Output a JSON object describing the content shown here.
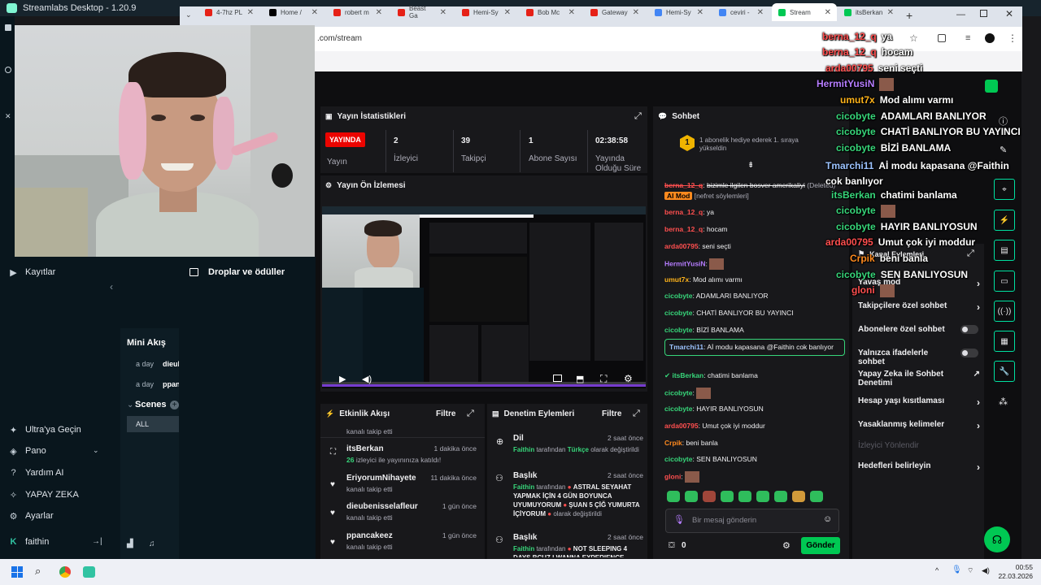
{
  "app": {
    "title": "Streamlabs Desktop - 1.20.9",
    "drops_title": "Droplar ve ödüller",
    "kayitlar": "Kayıtlar",
    "mini_akis": "Mini Akış",
    "mini_rows": [
      {
        "time": "a day",
        "text": "dieub"
      },
      {
        "time": "a day",
        "text": "ppan"
      }
    ],
    "scenes": "Scenes",
    "scene_all": "ALL",
    "nav": [
      {
        "label": "Ultra'ya Geçin",
        "icon": "ultra-icon"
      },
      {
        "label": "Pano",
        "icon": "dashboard-icon"
      },
      {
        "label": "Yardım AI",
        "icon": "help-ai-icon"
      },
      {
        "label": "YAPAY ZEKA",
        "icon": "ai-icon"
      },
      {
        "label": "Ayarlar",
        "icon": "settings-icon"
      }
    ],
    "user": "faithin"
  },
  "browser": {
    "tabs": [
      {
        "label": "4-7hz PL",
        "color": "#e62117"
      },
      {
        "label": "Home /",
        "color": "#000000"
      },
      {
        "label": "robert m",
        "color": "#e62117"
      },
      {
        "label": "Beast Ga",
        "color": "#e62117"
      },
      {
        "label": "Hemi-Sy",
        "color": "#e62117"
      },
      {
        "label": "Bob Mc",
        "color": "#e62117"
      },
      {
        "label": "Gateway",
        "color": "#e62117"
      },
      {
        "label": "Hemi-Sy",
        "color": "#4285f4"
      },
      {
        "label": "ceviri -",
        "color": "#4285f4"
      },
      {
        "label": "Stream",
        "color": "#00c853"
      },
      {
        "label": "itsBerkan",
        "color": "#00c853"
      }
    ],
    "url": ".com/stream"
  },
  "stats": {
    "title": "Yayın İstatistikleri",
    "live": "YAYINDA",
    "live_label": "Yayın",
    "items": [
      {
        "value": "2",
        "label": "İzleyici"
      },
      {
        "value": "39",
        "label": "Takipçi"
      },
      {
        "value": "1",
        "label": "Abone Sayısı"
      },
      {
        "value": "02:38:58",
        "label": "Yayında Olduğu Süre"
      }
    ]
  },
  "preview": {
    "title": "Yayın Ön İzlemesi"
  },
  "activity": {
    "title": "Etkinlik Akışı",
    "filter": "Filtre",
    "top_sub": "kanalı takip etti",
    "items": [
      {
        "name": "itsBerkan",
        "time": "1 dakika önce",
        "count": "26",
        "sub": "izleyici ile yayınınıza katıldı!"
      },
      {
        "name": "EriyorumNihayete",
        "time": "11 dakika önce",
        "sub": "kanalı takip etti"
      },
      {
        "name": "dieubenisselafleur",
        "time": "1 gün önce",
        "sub": "kanalı takip etti"
      },
      {
        "name": "ppancakeez",
        "time": "1 gün önce",
        "sub": "kanalı takip etti"
      }
    ]
  },
  "moderation": {
    "title": "Denetim Eylemleri",
    "filter": "Filtre",
    "items": [
      {
        "title": "Dil",
        "time": "2 saat önce",
        "who": "Faithin",
        "mid": "tarafından",
        "value": "Türkçe",
        "rest": "olarak değiştirildi"
      },
      {
        "title": "Başlık",
        "time": "2 saat önce",
        "who": "Faithin",
        "mid": "tarafından",
        "value": "ASTRAL SEYAHAT YAPMAK İÇİN 4 GÜN BOYUNCA UYUMUYORUM",
        "value2": "ŞUAN 5 ÇİĞ YUMURTA İÇİYORUM",
        "rest": "olarak değiştirildi"
      },
      {
        "title": "Başlık",
        "time": "2 saat önce",
        "who": "Faithin",
        "mid": "tarafından",
        "value": "NOT SLEEPING 4 DAYS BCUZ I WANNA EXPERIENCE"
      }
    ]
  },
  "chat": {
    "title": "Sohbet",
    "gift": "1 abonelik hediye ederek 1. sıraya yükseldin",
    "placeholder": "Bir mesaj gönderin",
    "send": "Gönder",
    "points": "0",
    "messages": [
      {
        "user": "berna_12_q",
        "color": "#ff4f4f",
        "text": "bizimle ilgilen bosver amerikaliyi",
        "extra": "(Deleted)",
        "badge": "AI Mod",
        "note": "[nefret söylemleri]"
      },
      {
        "user": "berna_12_q",
        "color": "#ff4f4f",
        "text": "ya"
      },
      {
        "user": "berna_12_q",
        "color": "#ff4f4f",
        "text": "hocam"
      },
      {
        "user": "arda00795",
        "color": "#ff4f4f",
        "text": "seni seçti"
      },
      {
        "user": "HermitYusiN",
        "color": "#b67dff",
        "text": ""
      },
      {
        "user": "umut7x",
        "color": "#ffb31a",
        "text": "Mod alımı varmı"
      },
      {
        "user": "cicobyte",
        "color": "#37d67a",
        "text": "ADAMLARI BANLIYOR"
      },
      {
        "user": "cicobyte",
        "color": "#37d67a",
        "text": "CHATİ BANLIYOR BU YAYINCI"
      },
      {
        "user": "cicobyte",
        "color": "#37d67a",
        "text": "BİZİ BANLAMA"
      },
      {
        "user": "Tmarchi11",
        "color": "#9cc3ff",
        "text": "Aİ modu kapasana @Faithin cok banlıyor"
      },
      {
        "user": "itsBerkan",
        "color": "#37d67a",
        "text": "chatimi banlama"
      },
      {
        "user": "cicobyte",
        "color": "#37d67a",
        "text": ""
      },
      {
        "user": "cicobyte",
        "color": "#37d67a",
        "text": "HAYIR BANLIYOSUN"
      },
      {
        "user": "arda00795",
        "color": "#ff4f4f",
        "text": "Umut çok iyi moddur"
      },
      {
        "user": "Crpik",
        "color": "#ff8a1e",
        "text": "beni banla"
      },
      {
        "user": "cicobyte",
        "color": "#37d67a",
        "text": "SEN BANLIYOSUN"
      },
      {
        "user": "gloni",
        "color": "#ff4f4f",
        "text": ""
      }
    ]
  },
  "channel_actions": {
    "title": "Kanal Eylemleri",
    "rows": [
      {
        "label": "Yavaş mod",
        "control": "chevron"
      },
      {
        "label": "Takipçilere özel sohbet",
        "control": "chevron"
      },
      {
        "label": "Abonelere özel sohbet",
        "control": "toggle"
      },
      {
        "label": "Yalnızca ifadelerle sohbet",
        "control": "toggle"
      },
      {
        "label": "Yapay Zeka ile Sohbet Denetimi",
        "control": "external"
      },
      {
        "label": "Hesap yaşı kısıtlaması",
        "control": "chevron"
      },
      {
        "label": "Yasaklanmış kelimeler",
        "control": "chevron"
      },
      {
        "label": "İzleyici Yönlendir",
        "control": "none"
      },
      {
        "label": "Hedefleri belirleyin",
        "control": "chevron"
      }
    ]
  },
  "overlay": [
    {
      "name": "berna_12_q",
      "color": "#ff4f4f",
      "text": "ya"
    },
    {
      "name": "berna_12_q",
      "color": "#ff4f4f",
      "text": "hocam"
    },
    {
      "name": "arda00795",
      "color": "#ff4f4f",
      "text": "seni seçti"
    },
    {
      "name": "HermitYusiN",
      "color": "#b67dff",
      "text": ""
    },
    {
      "name": "umut7x",
      "color": "#ffb31a",
      "text": "Mod alımı varmı"
    },
    {
      "name": "cicobyte",
      "color": "#37d67a",
      "text": "ADAMLARI BANLIYOR"
    },
    {
      "name": "cicobyte",
      "color": "#37d67a",
      "text": "CHATİ BANLIYOR BU YAYINCI"
    },
    {
      "name": "cicobyte",
      "color": "#37d67a",
      "text": "BİZİ BANLAMA"
    },
    {
      "name": "Tmarchi11",
      "color": "#9cc3ff",
      "text": "Aİ modu kapasana @Faithin cok banlıyor"
    },
    {
      "name": "itsBerkan",
      "color": "#37d67a",
      "text": "chatimi banlama"
    },
    {
      "name": "cicobyte",
      "color": "#37d67a",
      "text": ""
    },
    {
      "name": "cicobyte",
      "color": "#37d67a",
      "text": "HAYIR BANLIYOSUN"
    },
    {
      "name": "arda00795",
      "color": "#ff4f4f",
      "text": "Umut çok iyi moddur"
    },
    {
      "name": "Crpik",
      "color": "#ff8a1e",
      "text": "beni banla"
    },
    {
      "name": "cicobyte",
      "color": "#37d67a",
      "text": "SEN BANLIYOSUN"
    },
    {
      "name": "gloni",
      "color": "#ff4f4f",
      "text": ""
    }
  ],
  "taskbar": {
    "time": "00:55",
    "date": "22.03.2026"
  }
}
